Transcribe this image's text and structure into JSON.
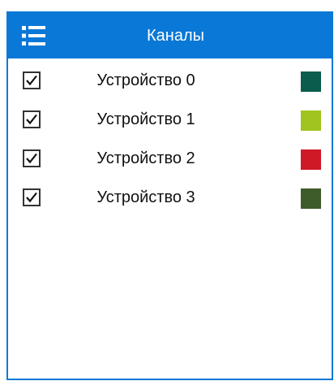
{
  "header": {
    "title": "Каналы",
    "menu_icon": "list-menu-icon",
    "background_color": "#0a78d7"
  },
  "channels": [
    {
      "label": "Устройство 0",
      "checked": true,
      "color": "#0b5c4d"
    },
    {
      "label": "Устройство 1",
      "checked": true,
      "color": "#a0c420"
    },
    {
      "label": "Устройство 2",
      "checked": true,
      "color": "#cf1926"
    },
    {
      "label": "Устройство 3",
      "checked": true,
      "color": "#3e5b2a"
    }
  ]
}
